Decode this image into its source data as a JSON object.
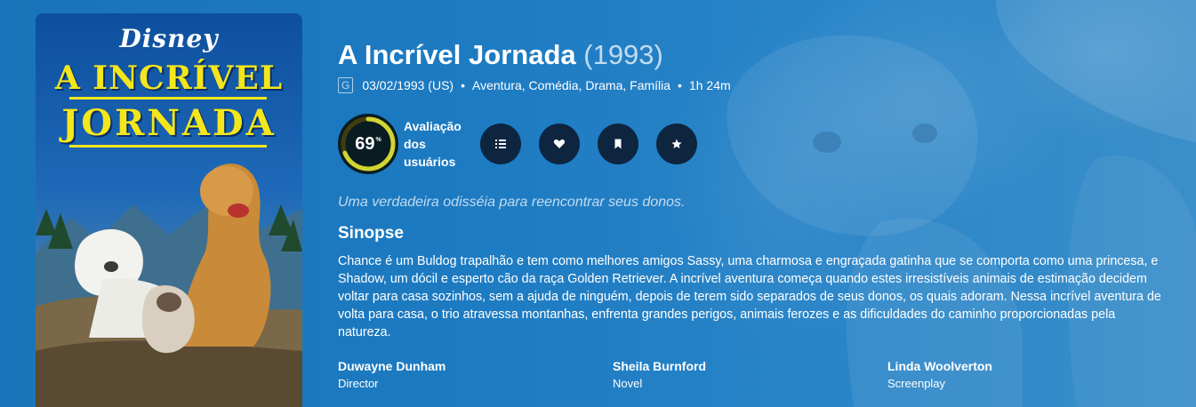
{
  "movie": {
    "title": "A Incrível Jornada",
    "year": "(1993)",
    "certification": "G",
    "release_date": "03/02/1993 (US)",
    "genres": "Aventura, Comédia, Drama, Família",
    "runtime": "1h 24m",
    "fact_separator": "•"
  },
  "poster": {
    "studio": "Disney",
    "title_line1": "A INCRÍVEL",
    "title_line2": "JORNADA"
  },
  "score": {
    "value": "69",
    "percent_sign": "%",
    "fraction": 0.69,
    "label": "Avaliação dos usuários",
    "ring_color": "#d2d531",
    "track_color": "#423d0f"
  },
  "actions": [
    {
      "name": "add-to-list",
      "icon": "list-icon"
    },
    {
      "name": "favorite",
      "icon": "heart-icon"
    },
    {
      "name": "watchlist",
      "icon": "bookmark-icon"
    },
    {
      "name": "rate",
      "icon": "star-icon"
    }
  ],
  "tagline": "Uma verdadeira odisséia para reencontrar seus donos.",
  "overview_heading": "Sinopse",
  "overview": "Chance é um Buldog trapalhão e tem como melhores amigos Sassy, uma charmosa e engraçada gatinha que se comporta como uma princesa, e Shadow, um dócil e esperto cão da raça Golden Retriever. A incrível aventura começa quando estes irresistíveis animais de estimação decidem voltar para casa sozinhos, sem a ajuda de ninguém, depois de terem sido separados de seus donos, os quais adoram. Nessa incrível aventura de volta para casa, o trio atravessa montanhas, enfrenta grandes perigos, animais ferozes e as dificuldades do caminho proporcionadas pela natureza.",
  "crew": [
    {
      "name": "Duwayne Dunham",
      "role": "Director"
    },
    {
      "name": "Sheila Burnford",
      "role": "Novel"
    },
    {
      "name": "Linda Woolverton",
      "role": "Screenplay"
    }
  ],
  "colors": {
    "background": "#1f7bc0",
    "button": "#0d253f",
    "score_bg": "#081c22",
    "poster_title": "#f3e61c"
  }
}
